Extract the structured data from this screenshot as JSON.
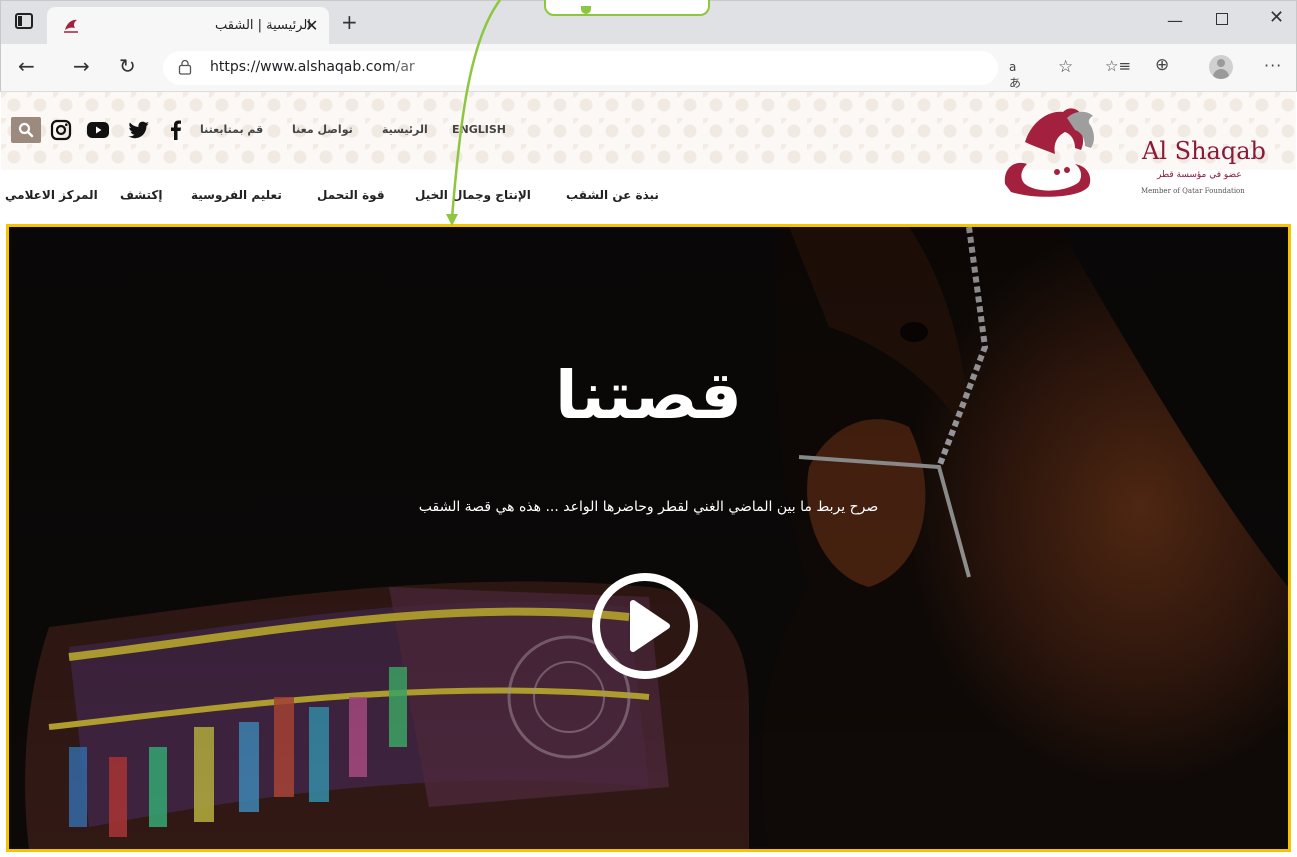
{
  "browser": {
    "tab_title": "الرئيسية | الشقب",
    "tab_close_glyph": "✕",
    "new_tab_glyph": "+",
    "url_host": "https://www.alshaqab.com",
    "url_path": "/ar",
    "window": {
      "minimize_glyph": "—",
      "close_glyph": "✕"
    },
    "toolbar": {
      "back_glyph": "←",
      "forward_glyph": "→",
      "refresh_glyph": "↻",
      "read_aloud": "aあ",
      "favorites_add_glyph": "☆",
      "favorites_glyph": "☆≡",
      "collections_glyph": "⊕",
      "more_glyph": "···"
    }
  },
  "header": {
    "top_links": {
      "english": "ENGLISH",
      "home": "الرئيسية",
      "contact": "تواصل معنا",
      "follow": "قم بمتابعتنا"
    },
    "social_icons": [
      "facebook-icon",
      "twitter-icon",
      "youtube-icon",
      "instagram-icon"
    ],
    "nav": [
      "نبذة عن الشقب",
      "الإنتاج وجمال الخيل",
      "قوة التحمل",
      "تعليم الفروسية",
      "إكتشف",
      "المركز الاعلامي"
    ],
    "logo": {
      "title_en": "Al Shaqab",
      "subtitle_ar": "عضو في مؤسسة قطر",
      "subtitle_en": "Member of Qatar Foundation"
    },
    "pattern_color": "#fbf8f5",
    "brand_color": "#8b1a3a"
  },
  "hero": {
    "title": "قصتنا",
    "subtitle": "صرح يربط ما بين الماضي الغني لقطر وحاضرها الواعد ... هذه هي قصة الشقب",
    "highlight_color": "#f5c400"
  },
  "annotation": {
    "color": "#8dc63f"
  }
}
